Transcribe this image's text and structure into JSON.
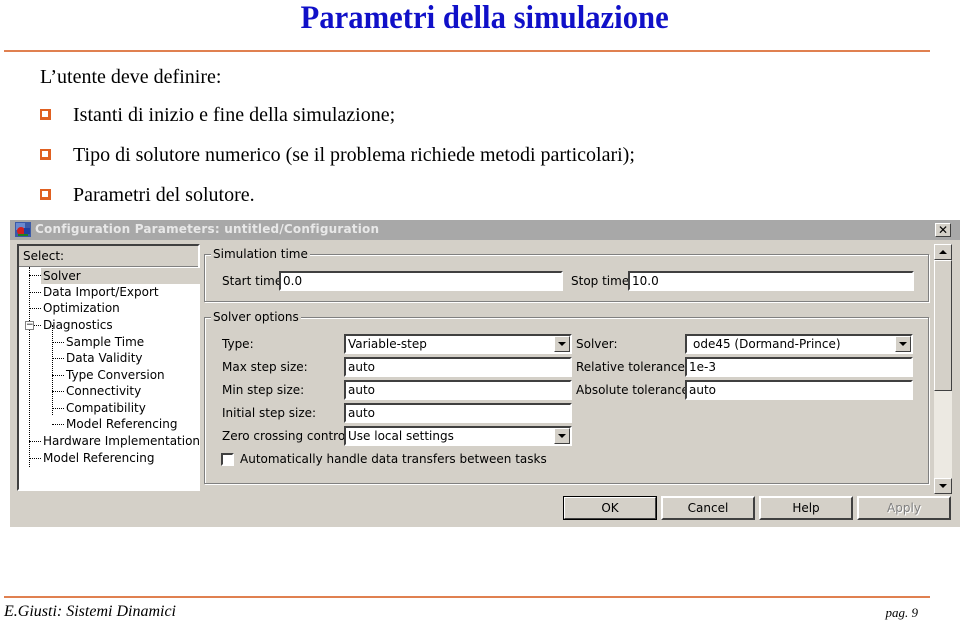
{
  "slide": {
    "title": "Parametri della simulazione",
    "intro": "L’utente deve definire:",
    "bullets": [
      "Istanti di inizio e fine della simulazione;",
      "Tipo di solutore numerico (se il problema richiede metodi particolari);",
      "Parametri del solutore."
    ],
    "footer_left": "E.Giusti: Sistemi Dinamici",
    "footer_right": "pag. 9",
    "accent_color": "#e06020",
    "title_color": "#1010c8"
  },
  "dialog": {
    "title": "Configuration Parameters: untitled/Configuration",
    "tree": {
      "header": "Select:",
      "items": [
        {
          "label": "Solver",
          "level": 0,
          "selected": true
        },
        {
          "label": "Data Import/Export",
          "level": 0
        },
        {
          "label": "Optimization",
          "level": 0
        },
        {
          "label": "Diagnostics",
          "level": 0,
          "expanded": true
        },
        {
          "label": "Sample Time",
          "level": 1
        },
        {
          "label": "Data Validity",
          "level": 1
        },
        {
          "label": "Type Conversion",
          "level": 1
        },
        {
          "label": "Connectivity",
          "level": 1
        },
        {
          "label": "Compatibility",
          "level": 1
        },
        {
          "label": "Model Referencing",
          "level": 1
        },
        {
          "label": "Hardware Implementation",
          "level": 0
        },
        {
          "label": "Model Referencing",
          "level": 0
        }
      ],
      "expander_symbol": "−"
    },
    "simulation_time": {
      "group_label": "Simulation time",
      "start_label": "Start time:",
      "start_value": "0.0",
      "stop_label": "Stop time:",
      "stop_value": "10.0"
    },
    "solver_options": {
      "group_label": "Solver options",
      "type_label": "Type:",
      "type_value": "Variable-step",
      "solver_label": "Solver:",
      "solver_value": "ode45 (Dormand-Prince)",
      "max_step_label": "Max step size:",
      "max_step_value": "auto",
      "rel_tol_label": "Relative tolerance:",
      "rel_tol_value": "1e-3",
      "min_step_label": "Min step size:",
      "min_step_value": "auto",
      "abs_tol_label": "Absolute tolerance:",
      "abs_tol_value": "auto",
      "init_step_label": "Initial step size:",
      "init_step_value": "auto",
      "zero_cross_label": "Zero crossing control:",
      "zero_cross_value": "Use local settings",
      "auto_transfer_label": "Automatically handle data transfers between tasks",
      "auto_transfer_checked": false
    },
    "buttons": {
      "ok": "OK",
      "cancel": "Cancel",
      "help": "Help",
      "apply": "Apply"
    },
    "close_symbol": "✕",
    "scrollbar_position": 0.0,
    "scrollbar_visible_fraction": 0.6
  }
}
